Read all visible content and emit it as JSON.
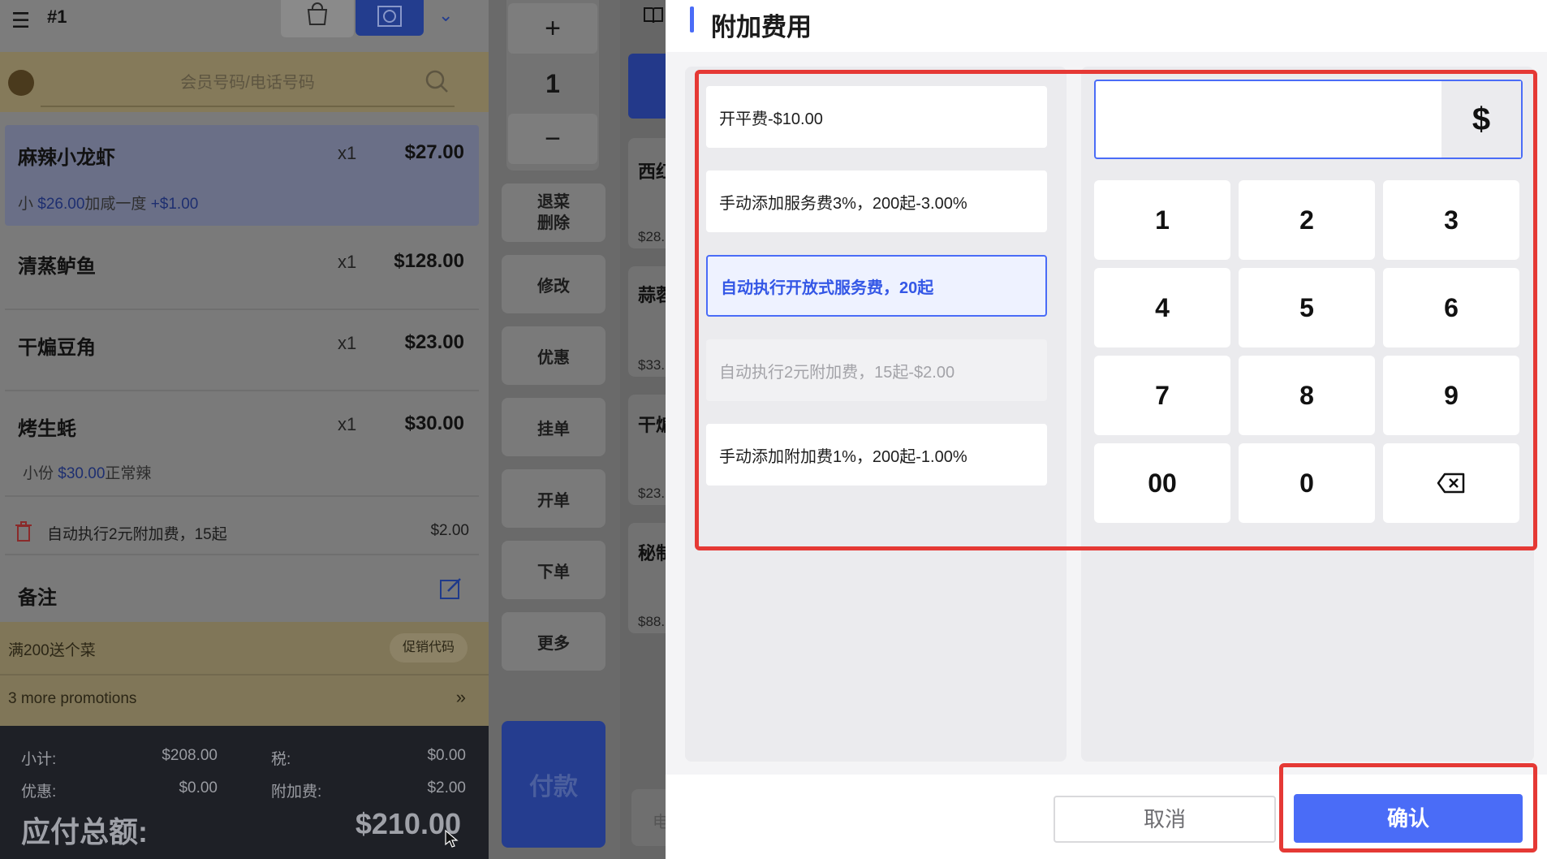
{
  "order": {
    "table": "#1",
    "member_placeholder": "会员号码/电话号码",
    "items": [
      {
        "name": "麻辣小龙虾",
        "qty": "x1",
        "price": "$27.00",
        "note_prefix": "小 ",
        "note_price": "$26.00",
        "note_mid": "加咸一度  ",
        "note_extra": "+$1.00"
      },
      {
        "name": "清蒸鲈鱼",
        "qty": "x1",
        "price": "$128.00"
      },
      {
        "name": "干煸豆角",
        "qty": "x1",
        "price": "$23.00"
      },
      {
        "name": "烤生蚝",
        "qty": "x1",
        "price": "$30.00",
        "note_prefix": "小份 ",
        "note_price": "$30.00",
        "note_mid": "正常辣"
      }
    ],
    "fee": {
      "label": "自动执行2元附加费，15起",
      "amount": "$2.00"
    },
    "remark_label": "备注",
    "promo": {
      "text": "满200送个菜",
      "code_button": "促销代码",
      "more": "3 more promotions",
      "more_arrow": "»"
    },
    "totals": {
      "subtotal_label": "小计:",
      "subtotal": "$208.00",
      "tax_label": "税:",
      "tax": "$0.00",
      "discount_label": "优惠:",
      "discount": "$0.00",
      "surcharge_label": "附加费:",
      "surcharge": "$2.00",
      "total_label": "应付总额:",
      "total": "$210.00"
    }
  },
  "actions": {
    "plus": "+",
    "qty": "1",
    "minus": "−",
    "void_delete": [
      "退菜",
      "删除"
    ],
    "modify": "修改",
    "discount": "优惠",
    "hold": "挂单",
    "open": "开单",
    "place_order": "下单",
    "more": "更多",
    "pay": "付款"
  },
  "menu": {
    "cards": [
      {
        "name": "西红",
        "price": "$28."
      },
      {
        "name": "蒜蓉",
        "price": "$33."
      },
      {
        "name": "干煸",
        "price": "$23."
      },
      {
        "name": "秘制",
        "price": "$88."
      }
    ],
    "input_hint": "电"
  },
  "modal": {
    "title": "附加费用",
    "options": [
      {
        "label": "开平费-$10.00",
        "state": "normal"
      },
      {
        "label": "手动添加服务费3%，200起-3.00%",
        "state": "normal"
      },
      {
        "label": "自动执行开放式服务费，20起",
        "state": "active"
      },
      {
        "label": "自动执行2元附加费，15起-$2.00",
        "state": "disabled"
      },
      {
        "label": "手动添加附加费1%，200起-1.00%",
        "state": "normal"
      }
    ],
    "amount_value": "",
    "currency": "$",
    "keys": [
      "1",
      "2",
      "3",
      "4",
      "5",
      "6",
      "7",
      "8",
      "9",
      "00",
      "0"
    ],
    "cancel": "取消",
    "confirm": "确认"
  },
  "colors": {
    "accent": "#4a6cf7",
    "highlight": "#e53935",
    "pay": "#253d8f"
  }
}
